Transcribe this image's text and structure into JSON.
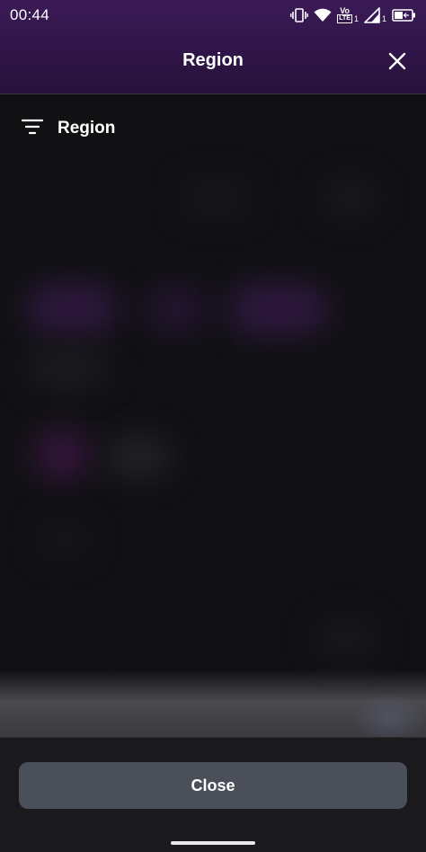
{
  "status_bar": {
    "time": "00:44",
    "vo_label": "Vo",
    "lte_label": "LTE",
    "sim1_sub": "1",
    "signal_sub": "1",
    "icons": [
      "vibrate-icon",
      "wifi-icon",
      "volte-icon",
      "signal-icon",
      "battery-icon"
    ]
  },
  "header": {
    "title": "Region",
    "close_icon": "close-icon"
  },
  "filter": {
    "icon": "filter-icon",
    "label": "Region"
  },
  "footer": {
    "close_label": "Close"
  },
  "colors": {
    "header_purple": "#3b1a56",
    "background": "#111114",
    "button": "#4a4f59",
    "text": "#ffffff"
  }
}
